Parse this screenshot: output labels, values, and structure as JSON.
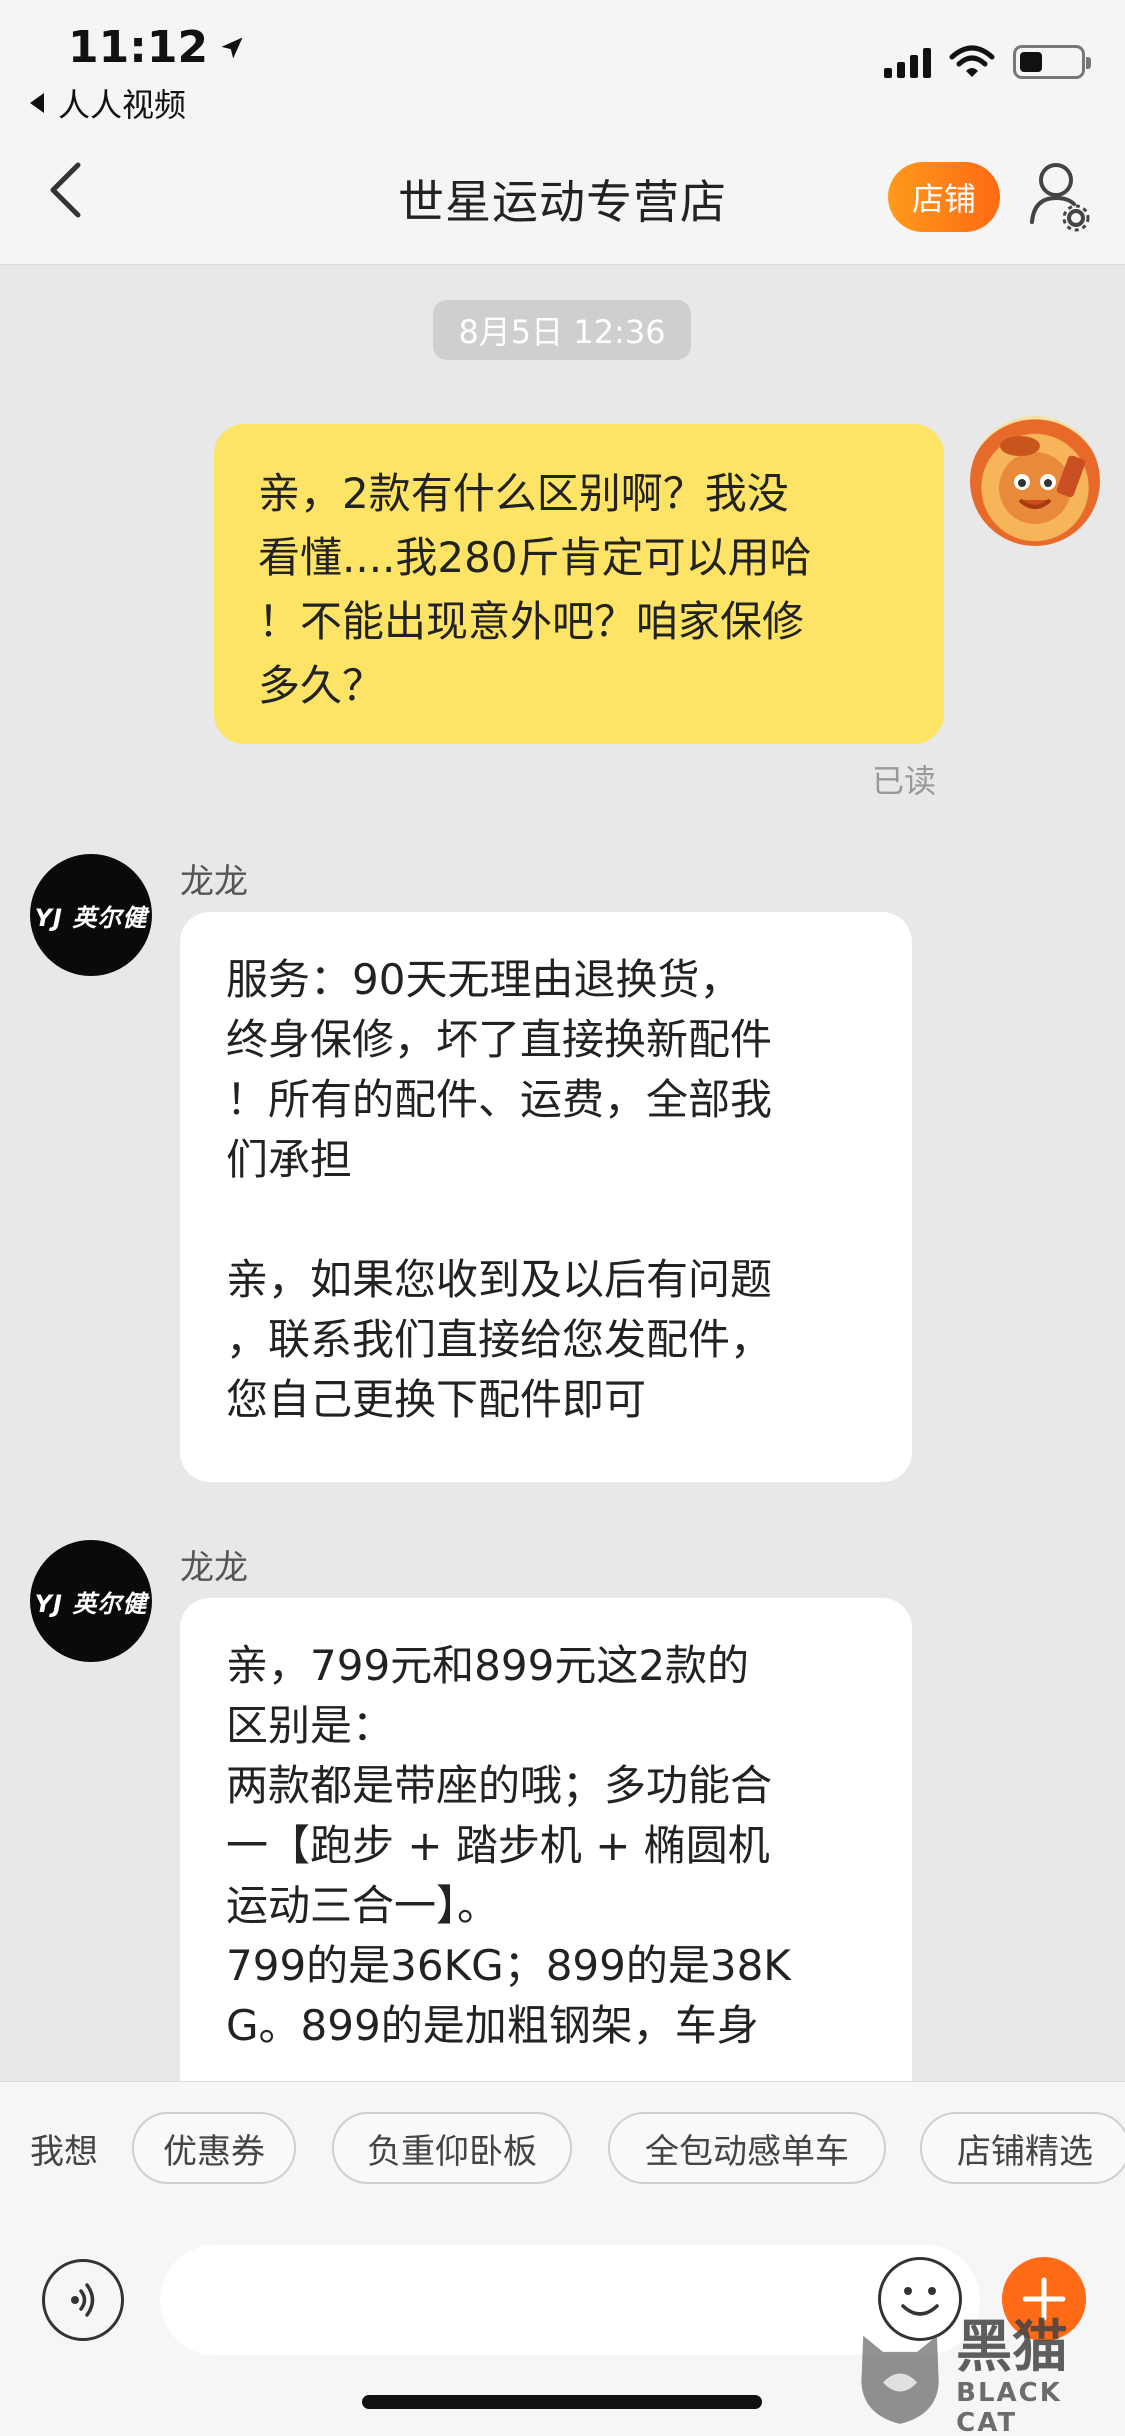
{
  "status_bar": {
    "time": "11:12",
    "back_app": "人人视频"
  },
  "nav": {
    "title": "世星运动专营店",
    "shop_button": "店铺"
  },
  "chat": {
    "timestamp": "8月5日 12:36",
    "outgoing": {
      "lines": [
        "亲，2款有什么区别啊？我没",
        "看懂....我280斤肯定可以用哈",
        "！不能出现意外吧？咱家保修",
        "多久？"
      ],
      "read_status": "已读"
    },
    "incoming": [
      {
        "sender": "龙龙",
        "avatar_logo": "YJ 英尔健",
        "lines": [
          "服务：90天无理由退换货，",
          "终身保修，坏了直接换新配件",
          "！所有的配件、运费，全部我",
          "们承担",
          "",
          "亲，如果您收到及以后有问题",
          "，联系我们直接给您发配件，",
          "您自己更换下配件即可"
        ]
      },
      {
        "sender": "龙龙",
        "avatar_logo": "YJ 英尔健",
        "lines": [
          "亲，799元和899元这2款的",
          "区别是：",
          "两款都是带座的哦；多功能合",
          "一【跑步 + 踏步机 + 椭圆机",
          "运动三合一】。",
          "799的是36KG；899的是38K",
          "G。899的是加粗钢架，车身"
        ]
      }
    ]
  },
  "quick_replies": {
    "label": "我想",
    "chips": [
      "优惠券",
      "负重仰卧板",
      "全包动感单车",
      "店铺精选"
    ]
  },
  "input": {
    "placeholder": ""
  },
  "watermark": {
    "cn": "黑猫",
    "en": "BLACK CAT"
  },
  "colors": {
    "accent": "#ff6a16",
    "outgoing_bubble": "#fde466",
    "incoming_bubble": "#ffffff",
    "chat_background": "#e8e8e8"
  }
}
